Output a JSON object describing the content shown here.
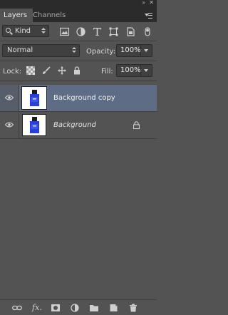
{
  "panel": {
    "tabs": [
      {
        "label": "Layers",
        "active": true
      },
      {
        "label": "Channels",
        "active": false
      }
    ]
  },
  "filter": {
    "kind_label": "Kind",
    "icons": [
      "pixel-layer-filter-icon",
      "adjustment-layer-filter-icon",
      "type-layer-filter-icon",
      "shape-layer-filter-icon",
      "smart-object-filter-icon",
      "filter-toggle-icon"
    ]
  },
  "blend": {
    "mode": "Normal",
    "opacity_label": "Opacity:",
    "opacity_value": "100%"
  },
  "lock": {
    "label": "Lock:",
    "icons": [
      "lock-transparent-pixels-icon",
      "lock-image-pixels-icon",
      "lock-position-icon",
      "lock-all-icon"
    ],
    "fill_label": "Fill:",
    "fill_value": "100%"
  },
  "layers": [
    {
      "name": "Background copy",
      "selected": true,
      "visible": true,
      "locked": false
    },
    {
      "name": "Background",
      "selected": false,
      "visible": true,
      "locked": true
    }
  ],
  "bottom_bar": {
    "fx_label": "fx.",
    "icons": [
      "link-layers-icon",
      "layer-style-icon",
      "add-mask-icon",
      "adjustment-layer-icon",
      "new-group-icon",
      "new-layer-icon",
      "delete-layer-icon"
    ]
  },
  "colors": {
    "panel_bg": "#535353",
    "selected_row": "#5e6d85",
    "thumb_blue": "#2a3fd6"
  }
}
